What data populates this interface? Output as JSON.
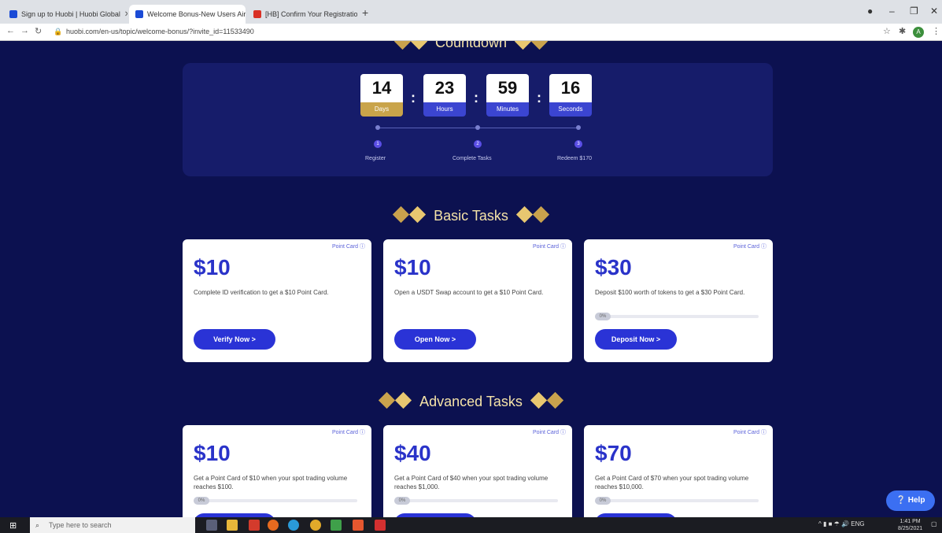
{
  "browser": {
    "tabs": [
      {
        "label": "Sign up to Huobi | Huobi Global",
        "active": false
      },
      {
        "label": "Welcome Bonus-New Users Airdr",
        "active": true
      },
      {
        "label": "[HB] Confirm Your Registration",
        "active": false
      }
    ],
    "new_tab": "+",
    "url": "huobi.com/en-us/topic/welcome-bonus/?invite_id=11533490",
    "profile_initial": "A"
  },
  "countdown": {
    "title": "Countdown",
    "units": [
      {
        "value": "14",
        "label": "Days"
      },
      {
        "value": "23",
        "label": "Hours"
      },
      {
        "value": "59",
        "label": "Minutes"
      },
      {
        "value": "16",
        "label": "Seconds"
      }
    ],
    "steps": [
      {
        "num": "1",
        "label": "Register"
      },
      {
        "num": "2",
        "label": "Complete Tasks"
      },
      {
        "num": "3",
        "label": "Redeem $170"
      }
    ]
  },
  "basic": {
    "title": "Basic Tasks",
    "cards": [
      {
        "badge": "Point Card ⓘ",
        "amount": "$10",
        "desc": "Complete ID verification to get a $10 Point Card.",
        "button": "Verify Now >",
        "progress": null
      },
      {
        "badge": "Point Card ⓘ",
        "amount": "$10",
        "desc": "Open a USDT Swap account to get a $10 Point Card.",
        "button": "Open Now >",
        "progress": null
      },
      {
        "badge": "Point Card ⓘ",
        "amount": "$30",
        "desc": "Deposit $100 worth of tokens to get a $30 Point Card.",
        "button": "Deposit Now >",
        "progress": "0%"
      }
    ]
  },
  "advanced": {
    "title": "Advanced Tasks",
    "cards": [
      {
        "badge": "Point Card ⓘ",
        "amount": "$10",
        "desc": "Get a Point Card of $10 when your spot trading volume reaches $100.",
        "progress": "0%"
      },
      {
        "badge": "Point Card ⓘ",
        "amount": "$40",
        "desc": "Get a Point Card of $40 when your spot trading volume reaches $1,000.",
        "progress": "0%"
      },
      {
        "badge": "Point Card ⓘ",
        "amount": "$70",
        "desc": "Get a Point Card of $70 when your spot trading volume reaches $10,000.",
        "progress": "0%"
      }
    ]
  },
  "help": {
    "label": "❔ Help"
  },
  "taskbar": {
    "search_placeholder": "Type here to search",
    "tray_text": "^  ▮  ■  ☂  🔊  ENG",
    "time": "1:41 PM",
    "date": "8/25/2021"
  },
  "colors": {
    "page_bg": "#0c1150",
    "accent": "#2a33d6",
    "gold": "#e8c770"
  }
}
